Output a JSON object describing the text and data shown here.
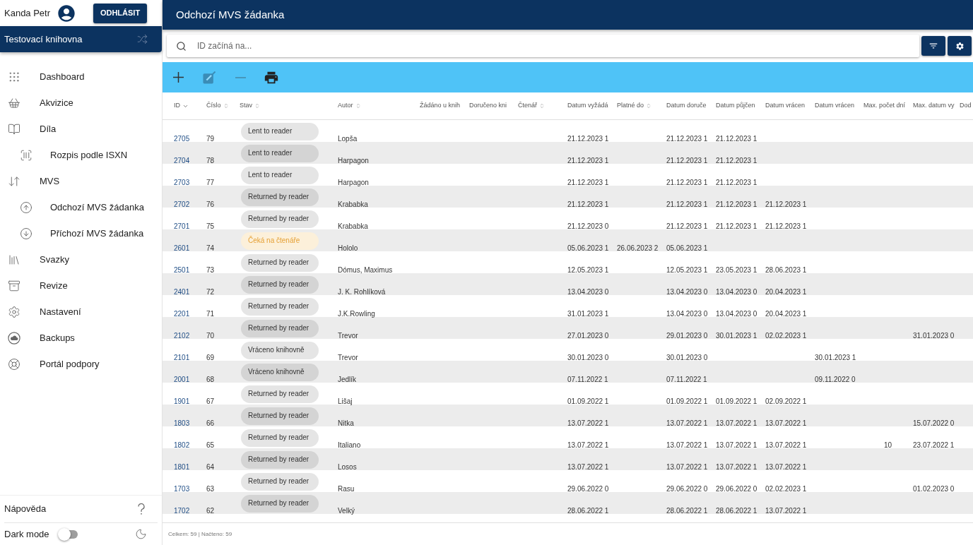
{
  "sidebar": {
    "user": {
      "name": "Kanda Petr"
    },
    "logout_button": "ODHLÁSIT",
    "library": "Testovací knihovna",
    "nav": [
      {
        "label": "Dashboard"
      },
      {
        "label": "Akvizice"
      },
      {
        "label": "Díla",
        "children": [
          {
            "label": "Rozpis podle ISXN"
          }
        ]
      },
      {
        "label": "MVS",
        "children": [
          {
            "label": "Odchozí MVS žádanka"
          },
          {
            "label": "Příchozí MVS žádanka"
          }
        ]
      },
      {
        "label": "Svazky"
      },
      {
        "label": "Revize"
      },
      {
        "label": "Nastavení"
      },
      {
        "label": "Backups"
      },
      {
        "label": "Portál podpory"
      }
    ],
    "help": "Nápověda",
    "dark_mode": {
      "label": "Dark mode",
      "on": false
    }
  },
  "header": {
    "title": "Odchozí MVS žádanka"
  },
  "search": {
    "placeholder": "ID začíná na..."
  },
  "toolbar": [
    {
      "kind": "add",
      "disabled": false
    },
    {
      "kind": "edit",
      "disabled": true
    },
    {
      "kind": "remove",
      "disabled": true
    },
    {
      "kind": "print",
      "disabled": false
    }
  ],
  "table": {
    "columns": [
      {
        "label": "ID",
        "sortable": true,
        "sorted": true
      },
      {
        "label": "Číslo",
        "sortable": true,
        "sorted": false
      },
      {
        "label": "Stav",
        "sortable": true,
        "sorted": false
      },
      {
        "label": "Autor",
        "sortable": true,
        "sorted": false
      },
      {
        "label": "Žádáno u knih",
        "sortable": false,
        "sorted": false
      },
      {
        "label": "Doručeno kni",
        "sortable": false,
        "sorted": false
      },
      {
        "label": "Čtenář",
        "sortable": true,
        "sorted": false
      },
      {
        "label": "Datum vyžádá",
        "sortable": false,
        "sorted": false
      },
      {
        "label": "Platné do",
        "sortable": true,
        "sorted": false
      },
      {
        "label": "Datum doruče",
        "sortable": false,
        "sorted": false
      },
      {
        "label": "Datum půjčen",
        "sortable": false,
        "sorted": false
      },
      {
        "label": "Datum vrácen",
        "sortable": false,
        "sorted": false
      },
      {
        "label": "Datum vrácen",
        "sortable": false,
        "sorted": false
      },
      {
        "label": "Max. počet dní",
        "sortable": false,
        "sorted": false
      },
      {
        "label": "Max. datum vy",
        "sortable": false,
        "sorted": false
      },
      {
        "label": "Dod",
        "sortable": false,
        "sorted": false
      }
    ],
    "rows": [
      {
        "id": "2705",
        "cislo": "79",
        "stav": {
          "label": "Lent to reader",
          "kind": "neutral"
        },
        "autor": "Lopša",
        "datum_vyzada": "21.12.2023 1",
        "datum_doruce": "21.12.2023 1",
        "datum_pujcen": "21.12.2023 1"
      },
      {
        "id": "2704",
        "cislo": "78",
        "stav": {
          "label": "Lent to reader",
          "kind": "neutral"
        },
        "autor": "Harpagon",
        "datum_vyzada": "21.12.2023 1",
        "datum_doruce": "21.12.2023 1",
        "datum_pujcen": "21.12.2023 1"
      },
      {
        "id": "2703",
        "cislo": "77",
        "stav": {
          "label": "Lent to reader",
          "kind": "neutral"
        },
        "autor": "Harpagon",
        "datum_vyzada": "21.12.2023 1",
        "datum_doruce": "21.12.2023 1",
        "datum_pujcen": "21.12.2023 1"
      },
      {
        "id": "2702",
        "cislo": "76",
        "stav": {
          "label": "Returned by reader",
          "kind": "neutral"
        },
        "autor": "Krababka",
        "datum_vyzada": "21.12.2023 1",
        "datum_doruce": "21.12.2023 1",
        "datum_pujcen": "21.12.2023 1",
        "datum_vracen": "21.12.2023 1"
      },
      {
        "id": "2701",
        "cislo": "75",
        "stav": {
          "label": "Returned by reader",
          "kind": "neutral"
        },
        "autor": "Krababka",
        "datum_vyzada": "21.12.2023 0",
        "datum_doruce": "21.12.2023 1",
        "datum_pujcen": "21.12.2023 1",
        "datum_vracen": "21.12.2023 1"
      },
      {
        "id": "2601",
        "cislo": "74",
        "stav": {
          "label": "Čeká na čtenáře",
          "kind": "pending"
        },
        "autor": "Hololo",
        "datum_vyzada": "05.06.2023 1",
        "platne_do": "26.06.2023 2",
        "datum_doruce": "05.06.2023 1"
      },
      {
        "id": "2501",
        "cislo": "73",
        "stav": {
          "label": "Returned by reader",
          "kind": "neutral"
        },
        "autor": "Dómus, Maximus",
        "datum_vyzada": "12.05.2023 1",
        "datum_doruce": "12.05.2023 1",
        "datum_pujcen": "23.05.2023 1",
        "datum_vracen": "28.06.2023 1"
      },
      {
        "id": "2401",
        "cislo": "72",
        "stav": {
          "label": "Returned by reader",
          "kind": "neutral"
        },
        "autor": "J. K. Rohlíková",
        "datum_vyzada": "13.04.2023 0",
        "datum_doruce": "13.04.2023 0",
        "datum_pujcen": "13.04.2023 0",
        "datum_vracen": "20.04.2023 1"
      },
      {
        "id": "2201",
        "cislo": "71",
        "stav": {
          "label": "Returned by reader",
          "kind": "neutral"
        },
        "autor": "J.K.Rowling",
        "datum_vyzada": "31.01.2023 1",
        "datum_doruce": "13.04.2023 0",
        "datum_pujcen": "13.04.2023 0",
        "datum_vracen": "20.04.2023 1"
      },
      {
        "id": "2102",
        "cislo": "70",
        "stav": {
          "label": "Returned by reader",
          "kind": "neutral"
        },
        "autor": "Trevor",
        "datum_vyzada": "27.01.2023 0",
        "datum_doruce": "29.01.2023 0",
        "datum_pujcen": "30.01.2023 1",
        "datum_vracen": "02.02.2023 1",
        "max_datum_vy": "31.01.2023 0"
      },
      {
        "id": "2101",
        "cislo": "69",
        "stav": {
          "label": "Vráceno knihovně",
          "kind": "neutral"
        },
        "autor": "Trevor",
        "datum_vyzada": "30.01.2023 0",
        "datum_doruce": "30.01.2023 0",
        "datum_vracen_2": "30.01.2023 1"
      },
      {
        "id": "2001",
        "cislo": "68",
        "stav": {
          "label": "Vráceno knihovně",
          "kind": "neutral"
        },
        "autor": "Jedlík",
        "datum_vyzada": "07.11.2022 1",
        "datum_doruce": "07.11.2022 1",
        "datum_vracen_2": "09.11.2022 0"
      },
      {
        "id": "1901",
        "cislo": "67",
        "stav": {
          "label": "Returned by reader",
          "kind": "neutral"
        },
        "autor": "Lišaj",
        "datum_vyzada": "01.09.2022 1",
        "datum_doruce": "01.09.2022 1",
        "datum_pujcen": "01.09.2022 1",
        "datum_vracen": "02.09.2022 1"
      },
      {
        "id": "1803",
        "cislo": "66",
        "stav": {
          "label": "Returned by reader",
          "kind": "neutral"
        },
        "autor": "Nitka",
        "datum_vyzada": "13.07.2022 1",
        "datum_doruce": "13.07.2022 1",
        "datum_pujcen": "13.07.2022 1",
        "datum_vracen": "13.07.2022 1",
        "max_datum_vy": "15.07.2022 0"
      },
      {
        "id": "1802",
        "cislo": "65",
        "stav": {
          "label": "Returned by reader",
          "kind": "neutral"
        },
        "autor": "Italiano",
        "datum_vyzada": "13.07.2022 1",
        "datum_doruce": "13.07.2022 1",
        "datum_pujcen": "13.07.2022 1",
        "datum_vracen": "13.07.2022 1",
        "max_pocet_dni": "10",
        "max_datum_vy": "23.07.2022 1"
      },
      {
        "id": "1801",
        "cislo": "64",
        "stav": {
          "label": "Returned by reader",
          "kind": "neutral"
        },
        "autor": "Losos",
        "datum_vyzada": "13.07.2022 1",
        "datum_doruce": "13.07.2022 1",
        "datum_pujcen": "13.07.2022 1",
        "datum_vracen": "13.07.2022 1"
      },
      {
        "id": "1703",
        "cislo": "63",
        "stav": {
          "label": "Returned by reader",
          "kind": "neutral"
        },
        "autor": "Rasu",
        "datum_vyzada": "29.06.2022 0",
        "datum_doruce": "29.06.2022 0",
        "datum_pujcen": "29.06.2022 0",
        "datum_vracen": "02.02.2023 1",
        "max_datum_vy": "01.02.2023 0"
      },
      {
        "id": "1702",
        "cislo": "62",
        "stav": {
          "label": "Returned by reader",
          "kind": "neutral"
        },
        "autor": "Velký",
        "datum_vyzada": "28.06.2022 1",
        "datum_doruce": "28.06.2022 1",
        "datum_pujcen": "28.06.2022 1",
        "datum_vracen": "13.07.2022 1"
      }
    ]
  },
  "status_bar": "Celkem: 59 | Načteno: 59"
}
